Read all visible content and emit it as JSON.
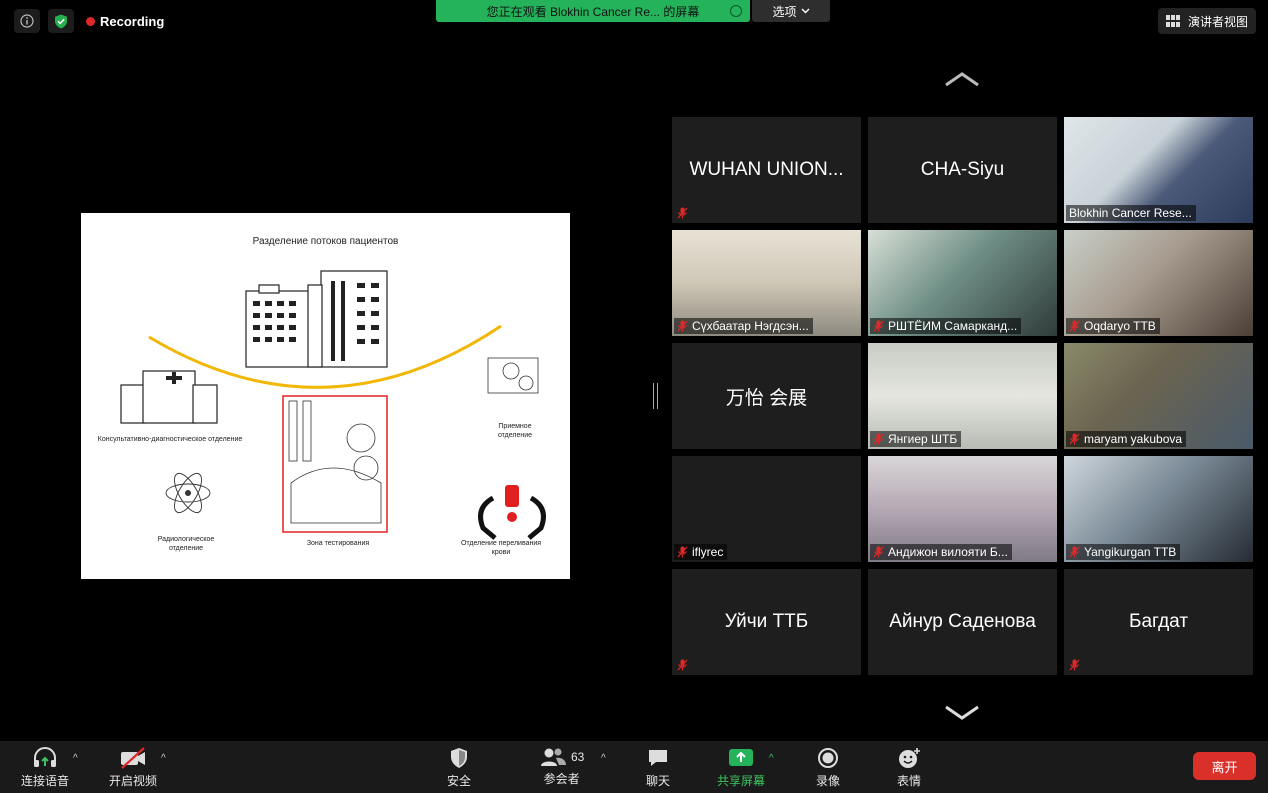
{
  "top": {
    "recording_label": "Recording",
    "share_banner": "您正在观看 Blokhin Cancer Re... 的屏幕",
    "options_label": "选项",
    "speaker_view_label": "演讲者视图"
  },
  "slide": {
    "title": "Разделение потоков пациентов",
    "labels": {
      "consult": "Консультативно-диагностическое отделение",
      "radio": "Радиологическое отделение",
      "testing": "Зона тестирования",
      "reception": "Приемное отделение",
      "transfusion": "Отделение переливания крови"
    }
  },
  "participants": [
    {
      "name": "WUHAN UNION...",
      "display": "WUHAN UNION...",
      "muted": true,
      "video": false
    },
    {
      "name": "CHA-Siyu",
      "display": "CHA-Siyu",
      "muted": false,
      "video": false
    },
    {
      "name": "Blokhin Cancer Rese...",
      "display": "",
      "muted": false,
      "video": true
    },
    {
      "name": "Сүхбаатар Нэгдсэн...",
      "display": "",
      "muted": true,
      "video": true
    },
    {
      "name": "РШТЁИМ Самарканд...",
      "display": "",
      "muted": true,
      "video": true
    },
    {
      "name": "Oqdaryo TTB",
      "display": "",
      "muted": true,
      "video": true
    },
    {
      "name": "万怡 会展",
      "display": "万怡 会展",
      "muted": false,
      "video": false
    },
    {
      "name": "Янгиер ШТБ",
      "display": "",
      "muted": true,
      "video": true
    },
    {
      "name": "maryam yakubova",
      "display": "",
      "muted": true,
      "video": true
    },
    {
      "name": "iflyrec",
      "display": "",
      "muted": true,
      "video": true,
      "active": true
    },
    {
      "name": "Андижон вилояти Б...",
      "display": "",
      "muted": true,
      "video": true
    },
    {
      "name": "Yangikurgan TTB",
      "display": "",
      "muted": true,
      "video": true
    },
    {
      "name": "Уйчи ТТБ",
      "display": "Уйчи ТТБ",
      "muted": true,
      "video": false
    },
    {
      "name": "Айнур Саденова",
      "display": "Айнур Саденова",
      "muted": false,
      "video": false
    },
    {
      "name": "Багдат",
      "display": "Багдат",
      "muted": true,
      "video": false
    }
  ],
  "toolbar": {
    "audio": "连接语音",
    "video": "开启视频",
    "security": "安全",
    "participants": "参会者",
    "participants_count": "63",
    "chat": "聊天",
    "share": "共享屏幕",
    "record": "录像",
    "reactions": "表情",
    "leave": "离开"
  },
  "colors": {
    "share_green": "#24b35a",
    "leave_red": "#d9302a",
    "active_speaker": "#c8e46a",
    "mute_red": "#e02828"
  }
}
